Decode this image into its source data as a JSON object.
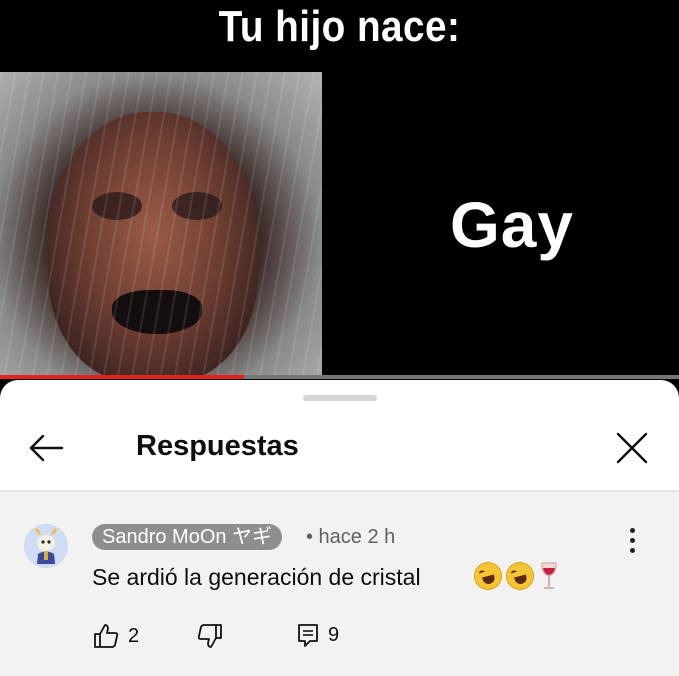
{
  "video": {
    "meme_title": "Tu hijo nace:",
    "overlay_text": "Gay",
    "progress": 0.36,
    "progress_color": "#e52222"
  },
  "sheet": {
    "title": "Respuestas",
    "back_icon": "arrow-left-icon",
    "close_icon": "close-icon"
  },
  "comment": {
    "author": "Sandro MoOn ヤギ",
    "meta": "• hace 2 h",
    "text": "Se ardió la generación de cristal",
    "emojis": [
      "rolling-laughing-emoji",
      "rolling-laughing-emoji",
      "wine-glass-emoji"
    ],
    "likes": "2",
    "replies": "9",
    "like_icon": "thumbs-up-icon",
    "dislike_icon": "thumbs-down-icon",
    "reply_icon": "reply-icon",
    "more_icon": "more-vert-icon"
  }
}
